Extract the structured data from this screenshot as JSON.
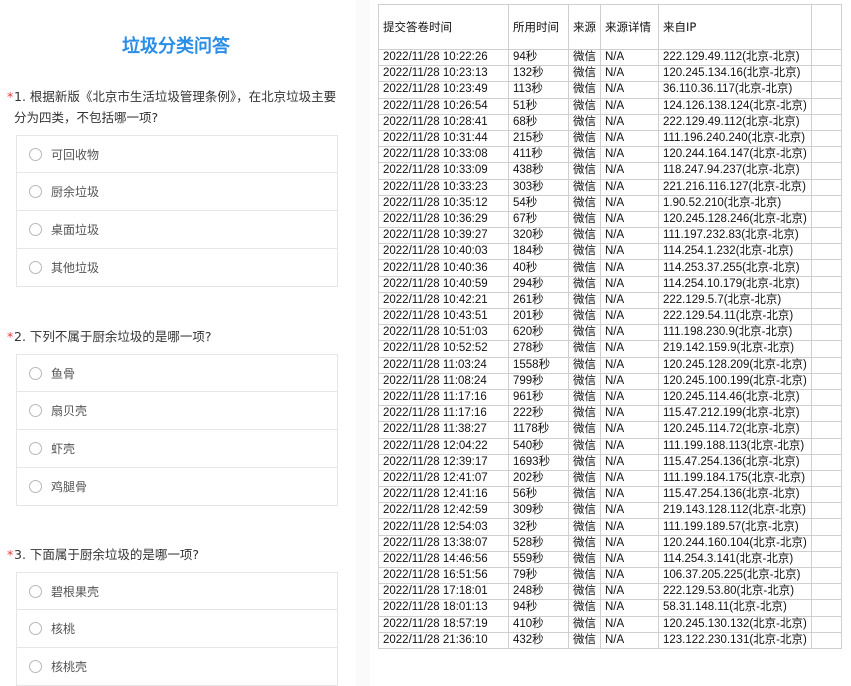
{
  "survey": {
    "title": "垃圾分类问答",
    "questions": [
      {
        "star": "*",
        "text": "1. 根据新版《北京市生活垃圾管理条例》，在北京垃圾主要分为四类，不包括哪一项?",
        "options": [
          "可回收物",
          "厨余垃圾",
          "桌面垃圾",
          "其他垃圾"
        ]
      },
      {
        "star": "*",
        "text": "2. 下列不属于厨余垃圾的是哪一项?",
        "options": [
          "鱼骨",
          "扇贝壳",
          "虾壳",
          "鸡腿骨"
        ]
      },
      {
        "star": "*",
        "text": "3. 下面属于厨余垃圾的是哪一项?",
        "options": [
          "碧根果壳",
          "核桃",
          "核桃壳"
        ]
      }
    ]
  },
  "table": {
    "headers": [
      "提交答卷时间",
      "所用时间",
      "来源",
      "来源详情",
      "来自IP",
      ""
    ],
    "rows": [
      [
        "2022/11/28 10:22:26",
        "94秒",
        "微信",
        "N/A",
        "222.129.49.112(北京-北京)"
      ],
      [
        "2022/11/28 10:23:13",
        "132秒",
        "微信",
        "N/A",
        "120.245.134.16(北京-北京)"
      ],
      [
        "2022/11/28 10:23:49",
        "113秒",
        "微信",
        "N/A",
        "36.110.36.117(北京-北京)"
      ],
      [
        "2022/11/28 10:26:54",
        "51秒",
        "微信",
        "N/A",
        "124.126.138.124(北京-北京)"
      ],
      [
        "2022/11/28 10:28:41",
        "68秒",
        "微信",
        "N/A",
        "222.129.49.112(北京-北京)"
      ],
      [
        "2022/11/28 10:31:44",
        "215秒",
        "微信",
        "N/A",
        "111.196.240.240(北京-北京)"
      ],
      [
        "2022/11/28 10:33:08",
        "411秒",
        "微信",
        "N/A",
        "120.244.164.147(北京-北京)"
      ],
      [
        "2022/11/28 10:33:09",
        "438秒",
        "微信",
        "N/A",
        "118.247.94.237(北京-北京)"
      ],
      [
        "2022/11/28 10:33:23",
        "303秒",
        "微信",
        "N/A",
        "221.216.116.127(北京-北京)"
      ],
      [
        "2022/11/28 10:35:12",
        "54秒",
        "微信",
        "N/A",
        "1.90.52.210(北京-北京)"
      ],
      [
        "2022/11/28 10:36:29",
        "67秒",
        "微信",
        "N/A",
        "120.245.128.246(北京-北京)"
      ],
      [
        "2022/11/28 10:39:27",
        "320秒",
        "微信",
        "N/A",
        "111.197.232.83(北京-北京)"
      ],
      [
        "2022/11/28 10:40:03",
        "184秒",
        "微信",
        "N/A",
        "114.254.1.232(北京-北京)"
      ],
      [
        "2022/11/28 10:40:36",
        "40秒",
        "微信",
        "N/A",
        "114.253.37.255(北京-北京)"
      ],
      [
        "2022/11/28 10:40:59",
        "294秒",
        "微信",
        "N/A",
        "114.254.10.179(北京-北京)"
      ],
      [
        "2022/11/28 10:42:21",
        "261秒",
        "微信",
        "N/A",
        "222.129.5.7(北京-北京)"
      ],
      [
        "2022/11/28 10:43:51",
        "201秒",
        "微信",
        "N/A",
        "222.129.54.11(北京-北京)"
      ],
      [
        "2022/11/28 10:51:03",
        "620秒",
        "微信",
        "N/A",
        "111.198.230.9(北京-北京)"
      ],
      [
        "2022/11/28 10:52:52",
        "278秒",
        "微信",
        "N/A",
        "219.142.159.9(北京-北京)"
      ],
      [
        "2022/11/28 11:03:24",
        "1558秒",
        "微信",
        "N/A",
        "120.245.128.209(北京-北京)"
      ],
      [
        "2022/11/28 11:08:24",
        "799秒",
        "微信",
        "N/A",
        "120.245.100.199(北京-北京)"
      ],
      [
        "2022/11/28 11:17:16",
        "961秒",
        "微信",
        "N/A",
        "120.245.114.46(北京-北京)"
      ],
      [
        "2022/11/28 11:17:16",
        "222秒",
        "微信",
        "N/A",
        "115.47.212.199(北京-北京)"
      ],
      [
        "2022/11/28 11:38:27",
        "1178秒",
        "微信",
        "N/A",
        "120.245.114.72(北京-北京)"
      ],
      [
        "2022/11/28 12:04:22",
        "540秒",
        "微信",
        "N/A",
        "111.199.188.113(北京-北京)"
      ],
      [
        "2022/11/28 12:39:17",
        "1693秒",
        "微信",
        "N/A",
        "115.47.254.136(北京-北京)"
      ],
      [
        "2022/11/28 12:41:07",
        "202秒",
        "微信",
        "N/A",
        "111.199.184.175(北京-北京)"
      ],
      [
        "2022/11/28 12:41:16",
        "56秒",
        "微信",
        "N/A",
        "115.47.254.136(北京-北京)"
      ],
      [
        "2022/11/28 12:42:59",
        "309秒",
        "微信",
        "N/A",
        "219.143.128.112(北京-北京)"
      ],
      [
        "2022/11/28 12:54:03",
        "32秒",
        "微信",
        "N/A",
        "111.199.189.57(北京-北京)"
      ],
      [
        "2022/11/28 13:38:07",
        "528秒",
        "微信",
        "N/A",
        "120.244.160.104(北京-北京)"
      ],
      [
        "2022/11/28 14:46:56",
        "559秒",
        "微信",
        "N/A",
        "114.254.3.141(北京-北京)"
      ],
      [
        "2022/11/28 16:51:56",
        "79秒",
        "微信",
        "N/A",
        "106.37.205.225(北京-北京)"
      ],
      [
        "2022/11/28 17:18:01",
        "248秒",
        "微信",
        "N/A",
        "222.129.53.80(北京-北京)"
      ],
      [
        "2022/11/28 18:01:13",
        "94秒",
        "微信",
        "N/A",
        "58.31.148.11(北京-北京)"
      ],
      [
        "2022/11/28 18:57:19",
        "410秒",
        "微信",
        "N/A",
        "120.245.130.132(北京-北京)"
      ],
      [
        "2022/11/28 21:36:10",
        "432秒",
        "微信",
        "N/A",
        "123.122.230.131(北京-北京)"
      ]
    ]
  },
  "colors": {
    "title_blue": "#2a8ee6",
    "required_red": "#e23a3a"
  }
}
